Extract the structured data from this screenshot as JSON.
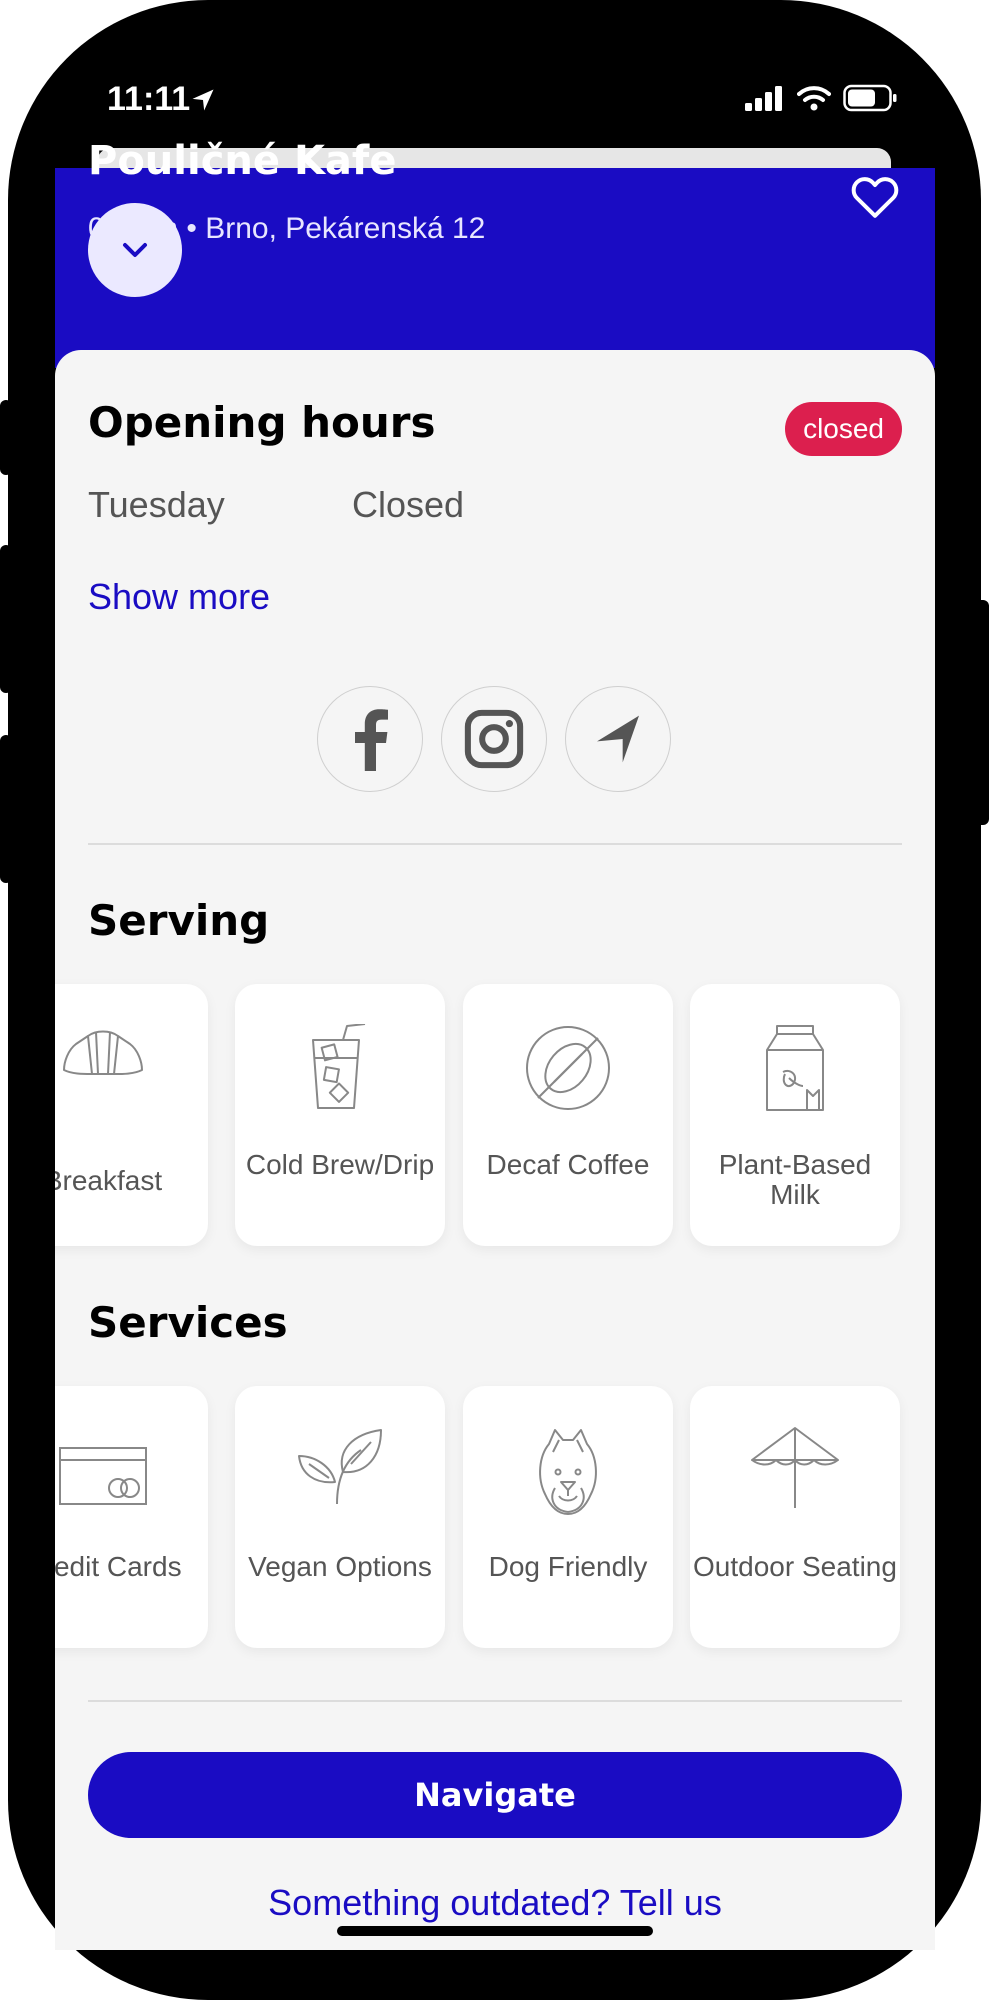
{
  "status_bar": {
    "time": "11:11"
  },
  "place": {
    "name": "Pouličné Kafe",
    "location": "0.1 km • Brno, Pekárenská 12"
  },
  "opening_hours": {
    "title": "Opening hours",
    "status": "closed",
    "day": "Tuesday",
    "hours": "Closed",
    "show_more": "Show more"
  },
  "serving": {
    "title": "Serving",
    "items": [
      {
        "label": "Breakfast",
        "icon": "croissant-icon"
      },
      {
        "label": "Cold Brew/Drip",
        "icon": "iced-drink-icon"
      },
      {
        "label": "Decaf Coffee",
        "icon": "decaf-bean-icon"
      },
      {
        "label": "Plant-Based Milk",
        "icon": "milk-carton-icon"
      }
    ]
  },
  "services": {
    "title": "Services",
    "items": [
      {
        "label": "Credit Cards",
        "icon": "credit-card-icon"
      },
      {
        "label": "Vegan Options",
        "icon": "leaf-icon"
      },
      {
        "label": "Dog Friendly",
        "icon": "dog-icon"
      },
      {
        "label": "Outdoor Seating",
        "icon": "umbrella-icon"
      }
    ]
  },
  "actions": {
    "navigate": "Navigate",
    "report": "Something outdated? Tell us"
  },
  "colors": {
    "accent": "#1a0cc3",
    "badge": "#dc1f4e",
    "sheet": "#f5f5f5"
  }
}
